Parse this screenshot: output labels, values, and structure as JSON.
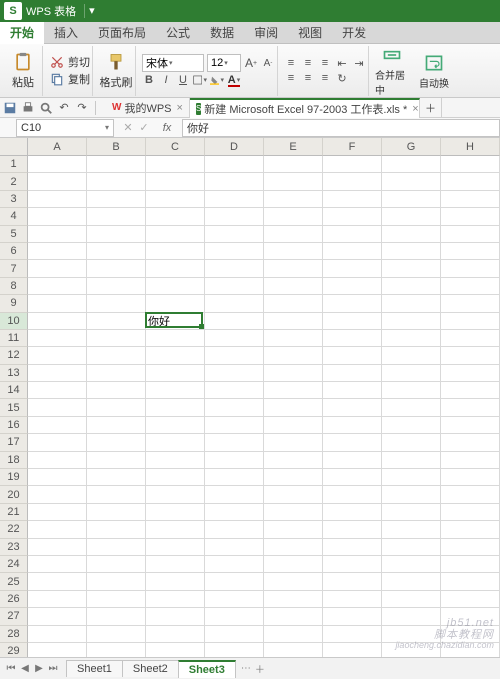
{
  "app": {
    "name": "WPS 表格",
    "logo": "S"
  },
  "ribbon_tabs": [
    "开始",
    "插入",
    "页面布局",
    "公式",
    "数据",
    "审阅",
    "视图",
    "开发"
  ],
  "active_ribbon_tab": 0,
  "clipboard": {
    "cut": "剪切",
    "copy": "复制",
    "paste": "粘贴",
    "format_painter": "格式刷"
  },
  "font": {
    "name": "宋体",
    "size": "12"
  },
  "align": {
    "merge_center": "合并居中",
    "autowrap": "自动换"
  },
  "doc_tabs": [
    {
      "label": "我的WPS",
      "type": "wps",
      "active": false,
      "closable": true
    },
    {
      "label": "新建 Microsoft Excel 97-2003 工作表.xls *",
      "type": "xls",
      "active": true,
      "closable": true
    }
  ],
  "namebox": "C10",
  "formula": "你好",
  "columns": [
    "A",
    "B",
    "C",
    "D",
    "E",
    "F",
    "G",
    "H"
  ],
  "row_count": 30,
  "selected": {
    "row": 10,
    "col": 3
  },
  "cell_data": {
    "10": {
      "3": "你好"
    }
  },
  "sheet_tabs": [
    "Sheet1",
    "Sheet2",
    "Sheet3"
  ],
  "active_sheet": 2,
  "watermark": {
    "line1": "jb51.net",
    "line2": "脚本教程网",
    "line3": "jiaocheng.chazidian.com"
  }
}
